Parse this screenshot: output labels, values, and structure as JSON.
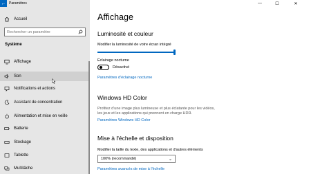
{
  "window": {
    "title": "Paramètres",
    "back_glyph": "←",
    "controls": {
      "minimize": "—",
      "maximize": "☐",
      "close": "✕"
    }
  },
  "sidebar": {
    "home": {
      "label": "Accueil",
      "icon": "home-icon"
    },
    "search": {
      "placeholder": "Rechercher un paramètre"
    },
    "section_title": "Système",
    "items": [
      {
        "label": "Affichage",
        "icon": "display-icon"
      },
      {
        "label": "Son",
        "icon": "speaker-icon"
      },
      {
        "label": "Notifications et actions",
        "icon": "notifications-icon"
      },
      {
        "label": "Assistant de concentration",
        "icon": "focus-moon-icon"
      },
      {
        "label": "Alimentation et mise en veille",
        "icon": "power-icon"
      },
      {
        "label": "Batterie",
        "icon": "battery-icon"
      },
      {
        "label": "Stockage",
        "icon": "storage-icon"
      },
      {
        "label": "Tablette",
        "icon": "tablet-icon"
      },
      {
        "label": "Multitâche",
        "icon": "multitask-icon"
      }
    ],
    "hovered_item": "Son"
  },
  "main": {
    "title": "Affichage",
    "brightness": {
      "heading": "Luminosité et couleur",
      "slider_label": "Modifier la luminosité de votre écran intégré",
      "value_fraction": 1.0,
      "night_light_label": "Éclairage nocturne",
      "night_light_state": "Désactivé",
      "night_light_link": "Paramètres d'éclairage nocturne"
    },
    "hdr": {
      "heading": "Windows HD Color",
      "desc_line1": "Profitez d'une image plus lumineuse et plus éclatante pour les vidéos,",
      "desc_line2": "les jeux et les applications qui prennent en charge HDR.",
      "link": "Paramètres Windows HD Color"
    },
    "scale": {
      "heading": "Mise à l'échelle et disposition",
      "label": "Modifier la taille du texte, des applications et d'autres éléments",
      "selected": "100% (recommandé)",
      "link": "Paramètres avancés de mise à l'échelle"
    }
  },
  "colors": {
    "accent": "#0067c0",
    "sidebar_bg": "#e6e6e6",
    "hover_bg": "#d0d0d0"
  }
}
